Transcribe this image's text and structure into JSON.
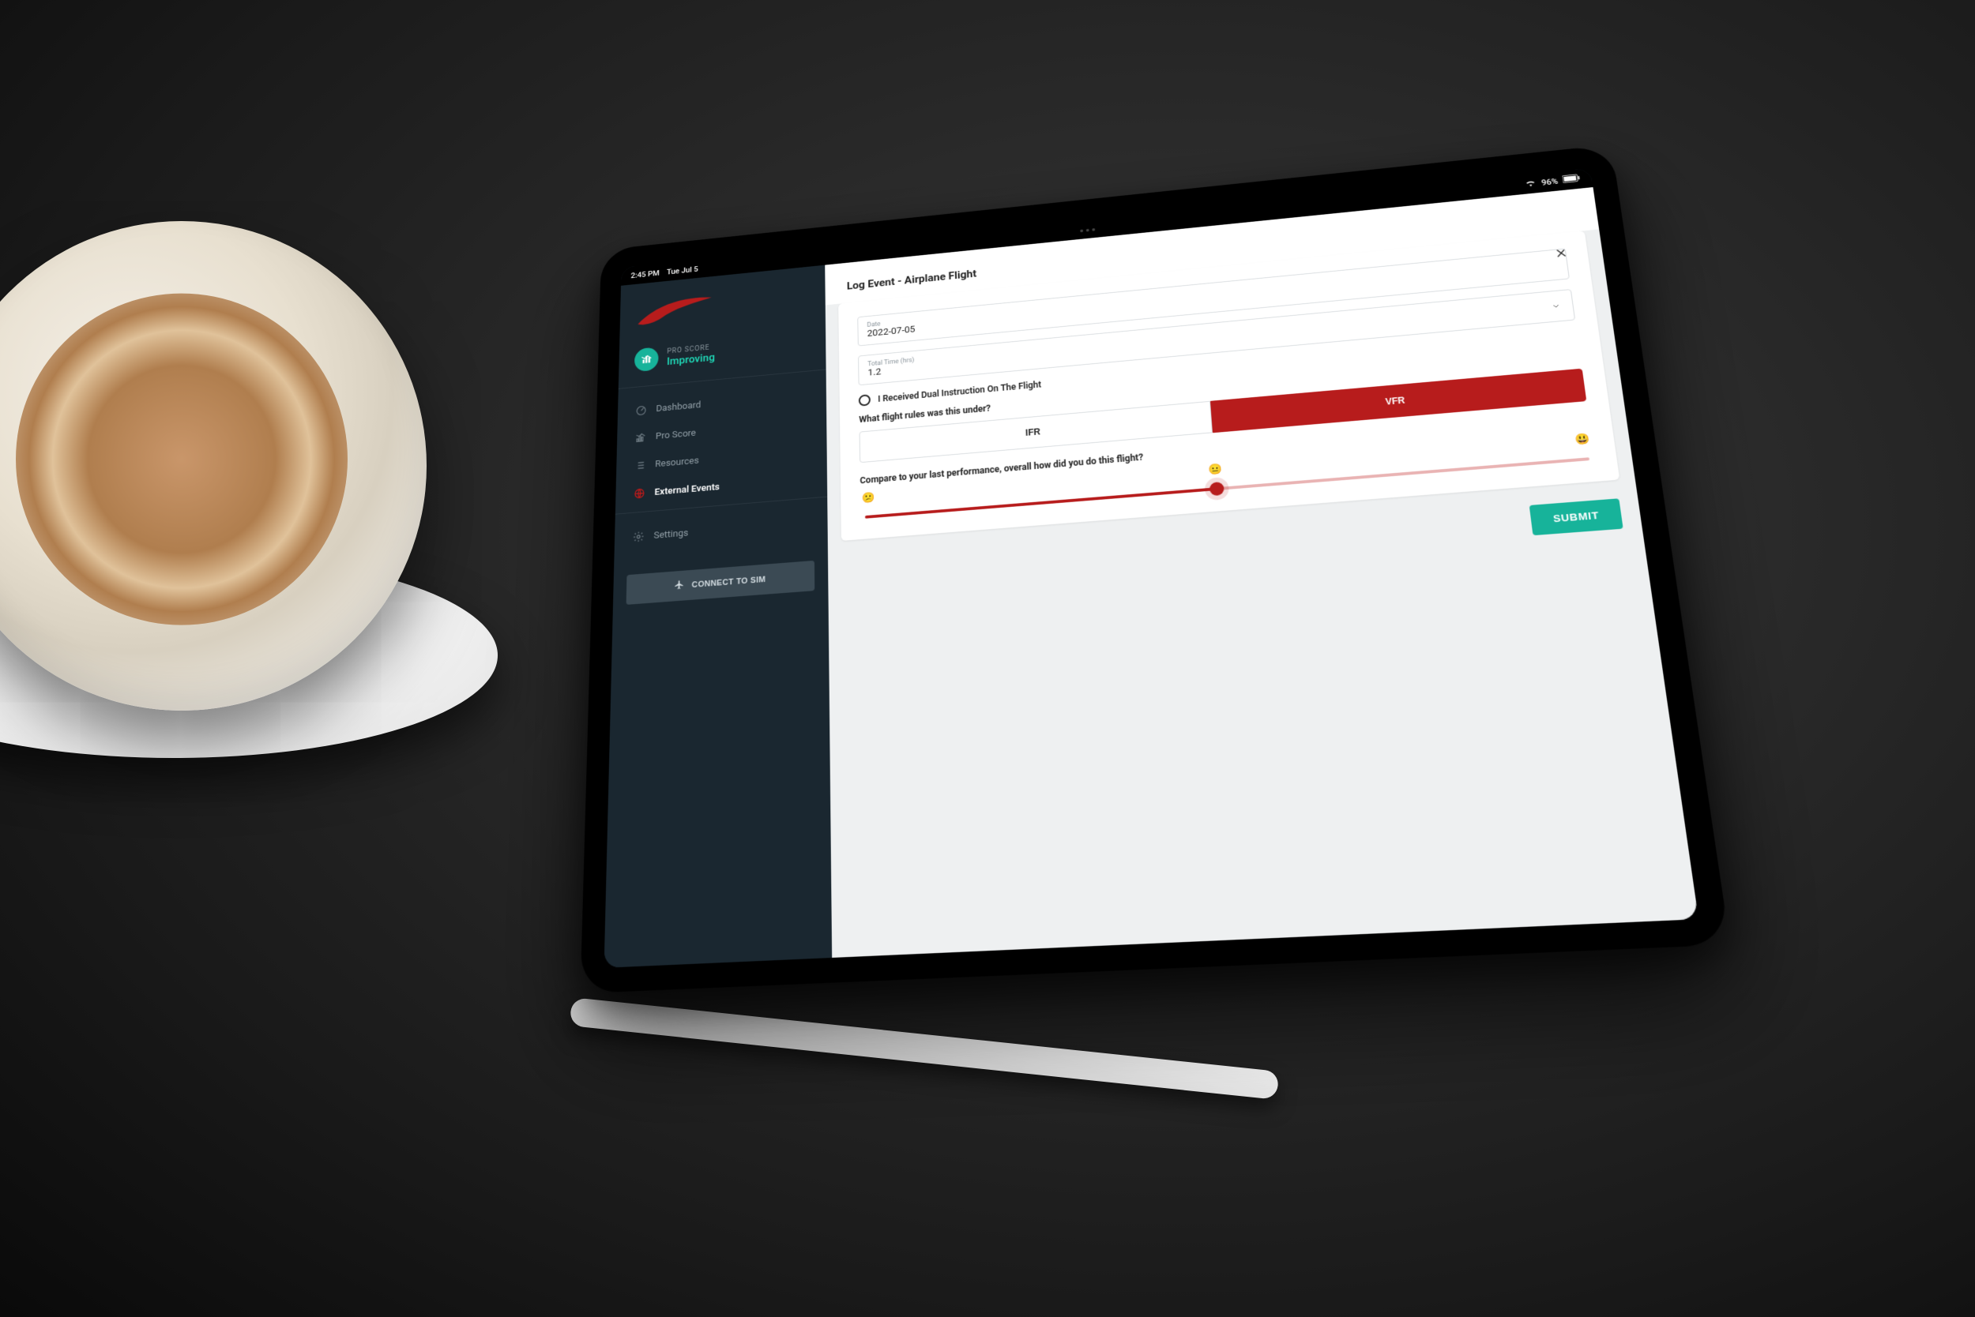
{
  "status": {
    "time": "2:45 PM",
    "date": "Tue Jul 5",
    "battery": "96%"
  },
  "proscore": {
    "label": "PRO SCORE",
    "value": "Improving"
  },
  "nav": {
    "dashboard": "Dashboard",
    "proscore": "Pro Score",
    "resources": "Resources",
    "external": "External Events",
    "settings": "Settings"
  },
  "connect_label": "CONNECT TO SIM",
  "page_title": "Log Event - Airplane Flight",
  "fields": {
    "date": {
      "label": "Date",
      "value": "2022-07-05"
    },
    "total_time": {
      "label": "Total Time (hrs)",
      "value": "1.2"
    }
  },
  "dual_instruction_label": "I Received Dual Instruction On The Flight",
  "flight_rules": {
    "question": "What flight rules was this under?",
    "ifr": "IFR",
    "vfr": "VFR",
    "selected": "VFR"
  },
  "performance": {
    "question": "Compare to your last performance, overall how did you do this flight?",
    "emoji_low": "😕",
    "emoji_mid": "😐",
    "emoji_high": "😃"
  },
  "submit_label": "SUBMIT"
}
